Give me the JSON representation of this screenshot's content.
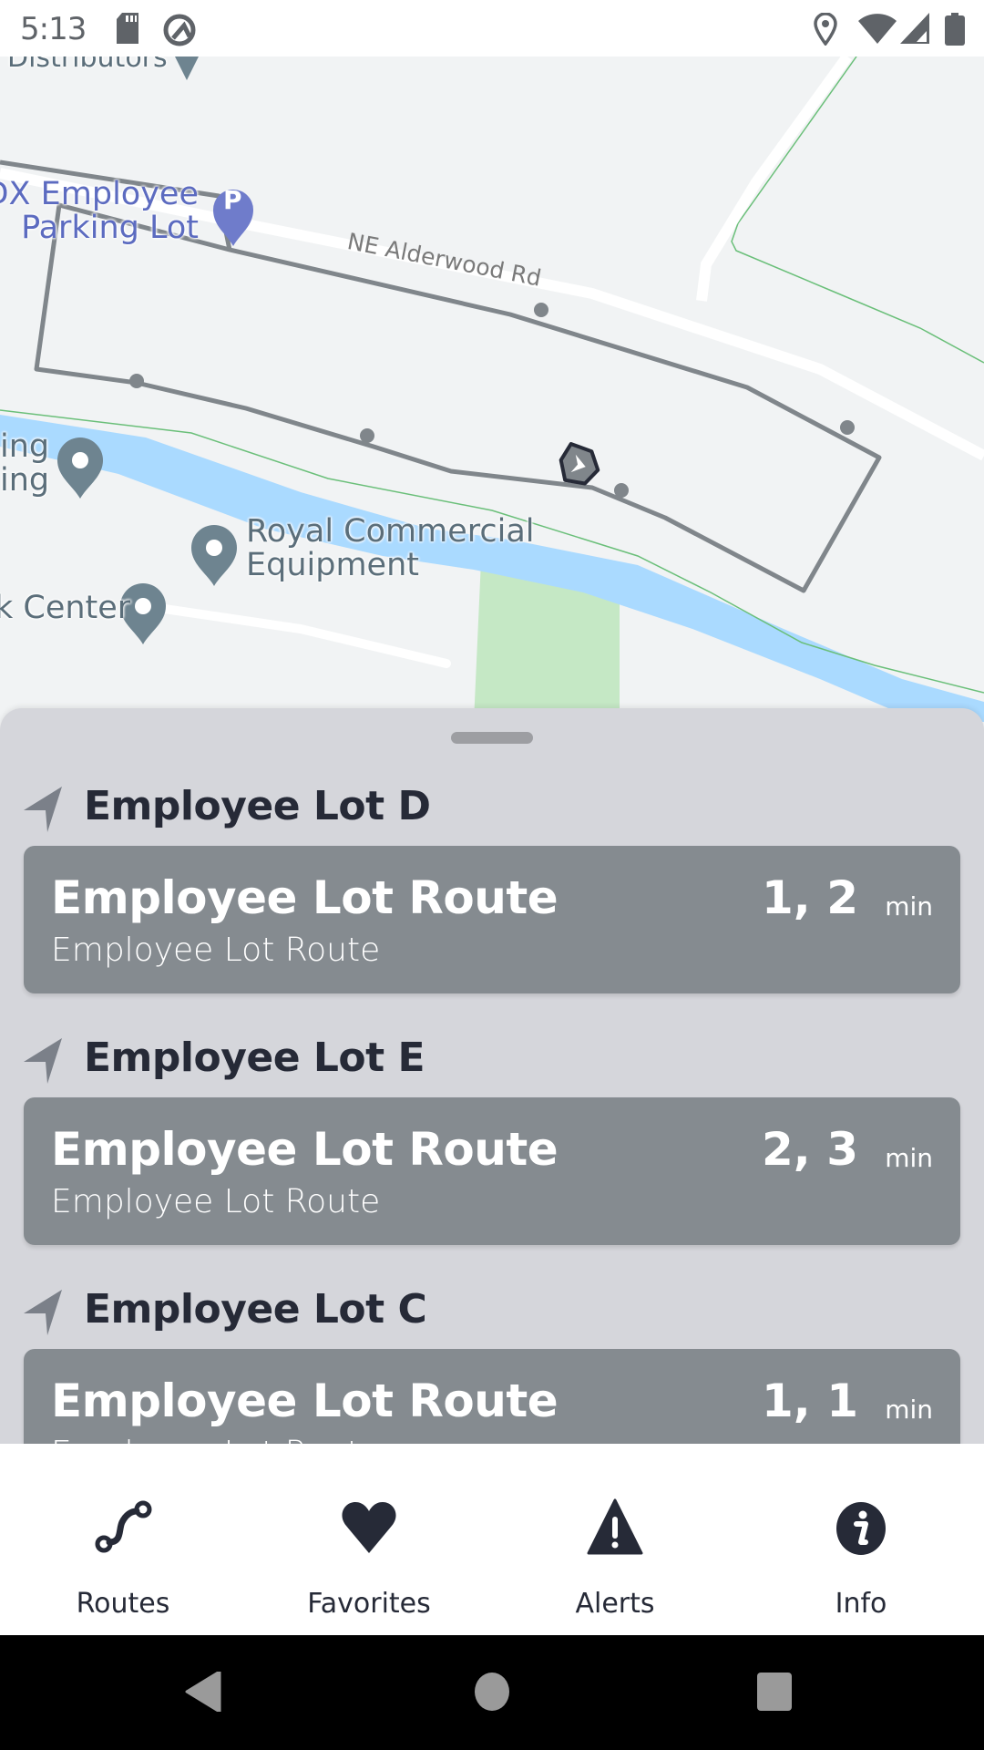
{
  "status_bar": {
    "time": "5:13",
    "left_icons": [
      "sd-card-icon",
      "android-q-icon"
    ],
    "right_icons": [
      "location-icon",
      "wifi-icon",
      "signal-icon",
      "battery-icon"
    ]
  },
  "map": {
    "labels": {
      "top_cut": "Distributors",
      "parking_line1": "PDX Employee",
      "parking_line2": "Parking Lot",
      "road": "NE Alderwood Rd",
      "poi_left_line1": "ing",
      "poi_left_line2": "ing",
      "poi_royal_line1": "Royal Commercial",
      "poi_royal_line2": "Equipment",
      "poi_center": "k Center"
    },
    "parking_glyph": "P",
    "colors": {
      "background": "#f1f3f4",
      "water": "#aadaff",
      "park": "#c5e8c5",
      "route": "#80868b",
      "parking_pin": "#6f7ccb",
      "poi_pin": "#6e8490",
      "boundary": "#6abf79"
    }
  },
  "sheet": {
    "stops": [
      {
        "name": "Employee Lot D",
        "route_title": "Employee Lot Route",
        "route_subtitle": "Employee Lot Route",
        "arrivals": "1, 2",
        "unit": "min"
      },
      {
        "name": "Employee Lot E",
        "route_title": "Employee Lot Route",
        "route_subtitle": "Employee Lot Route",
        "arrivals": "2, 3",
        "unit": "min"
      },
      {
        "name": "Employee Lot C",
        "route_title": "Employee Lot Route",
        "route_subtitle": "Employee Lot Route",
        "arrivals": "1, 1",
        "unit": "min"
      }
    ],
    "colors": {
      "sheet_bg": "#d5d6db",
      "card_bg": "#858b90",
      "header_text": "#262a37"
    }
  },
  "bottom_nav": {
    "items": [
      {
        "label": "Routes",
        "icon": "routes-icon"
      },
      {
        "label": "Favorites",
        "icon": "heart-icon"
      },
      {
        "label": "Alerts",
        "icon": "alert-icon"
      },
      {
        "label": "Info",
        "icon": "info-icon"
      }
    ]
  },
  "system_nav": {
    "buttons": [
      "back-button",
      "home-button",
      "recents-button"
    ]
  }
}
